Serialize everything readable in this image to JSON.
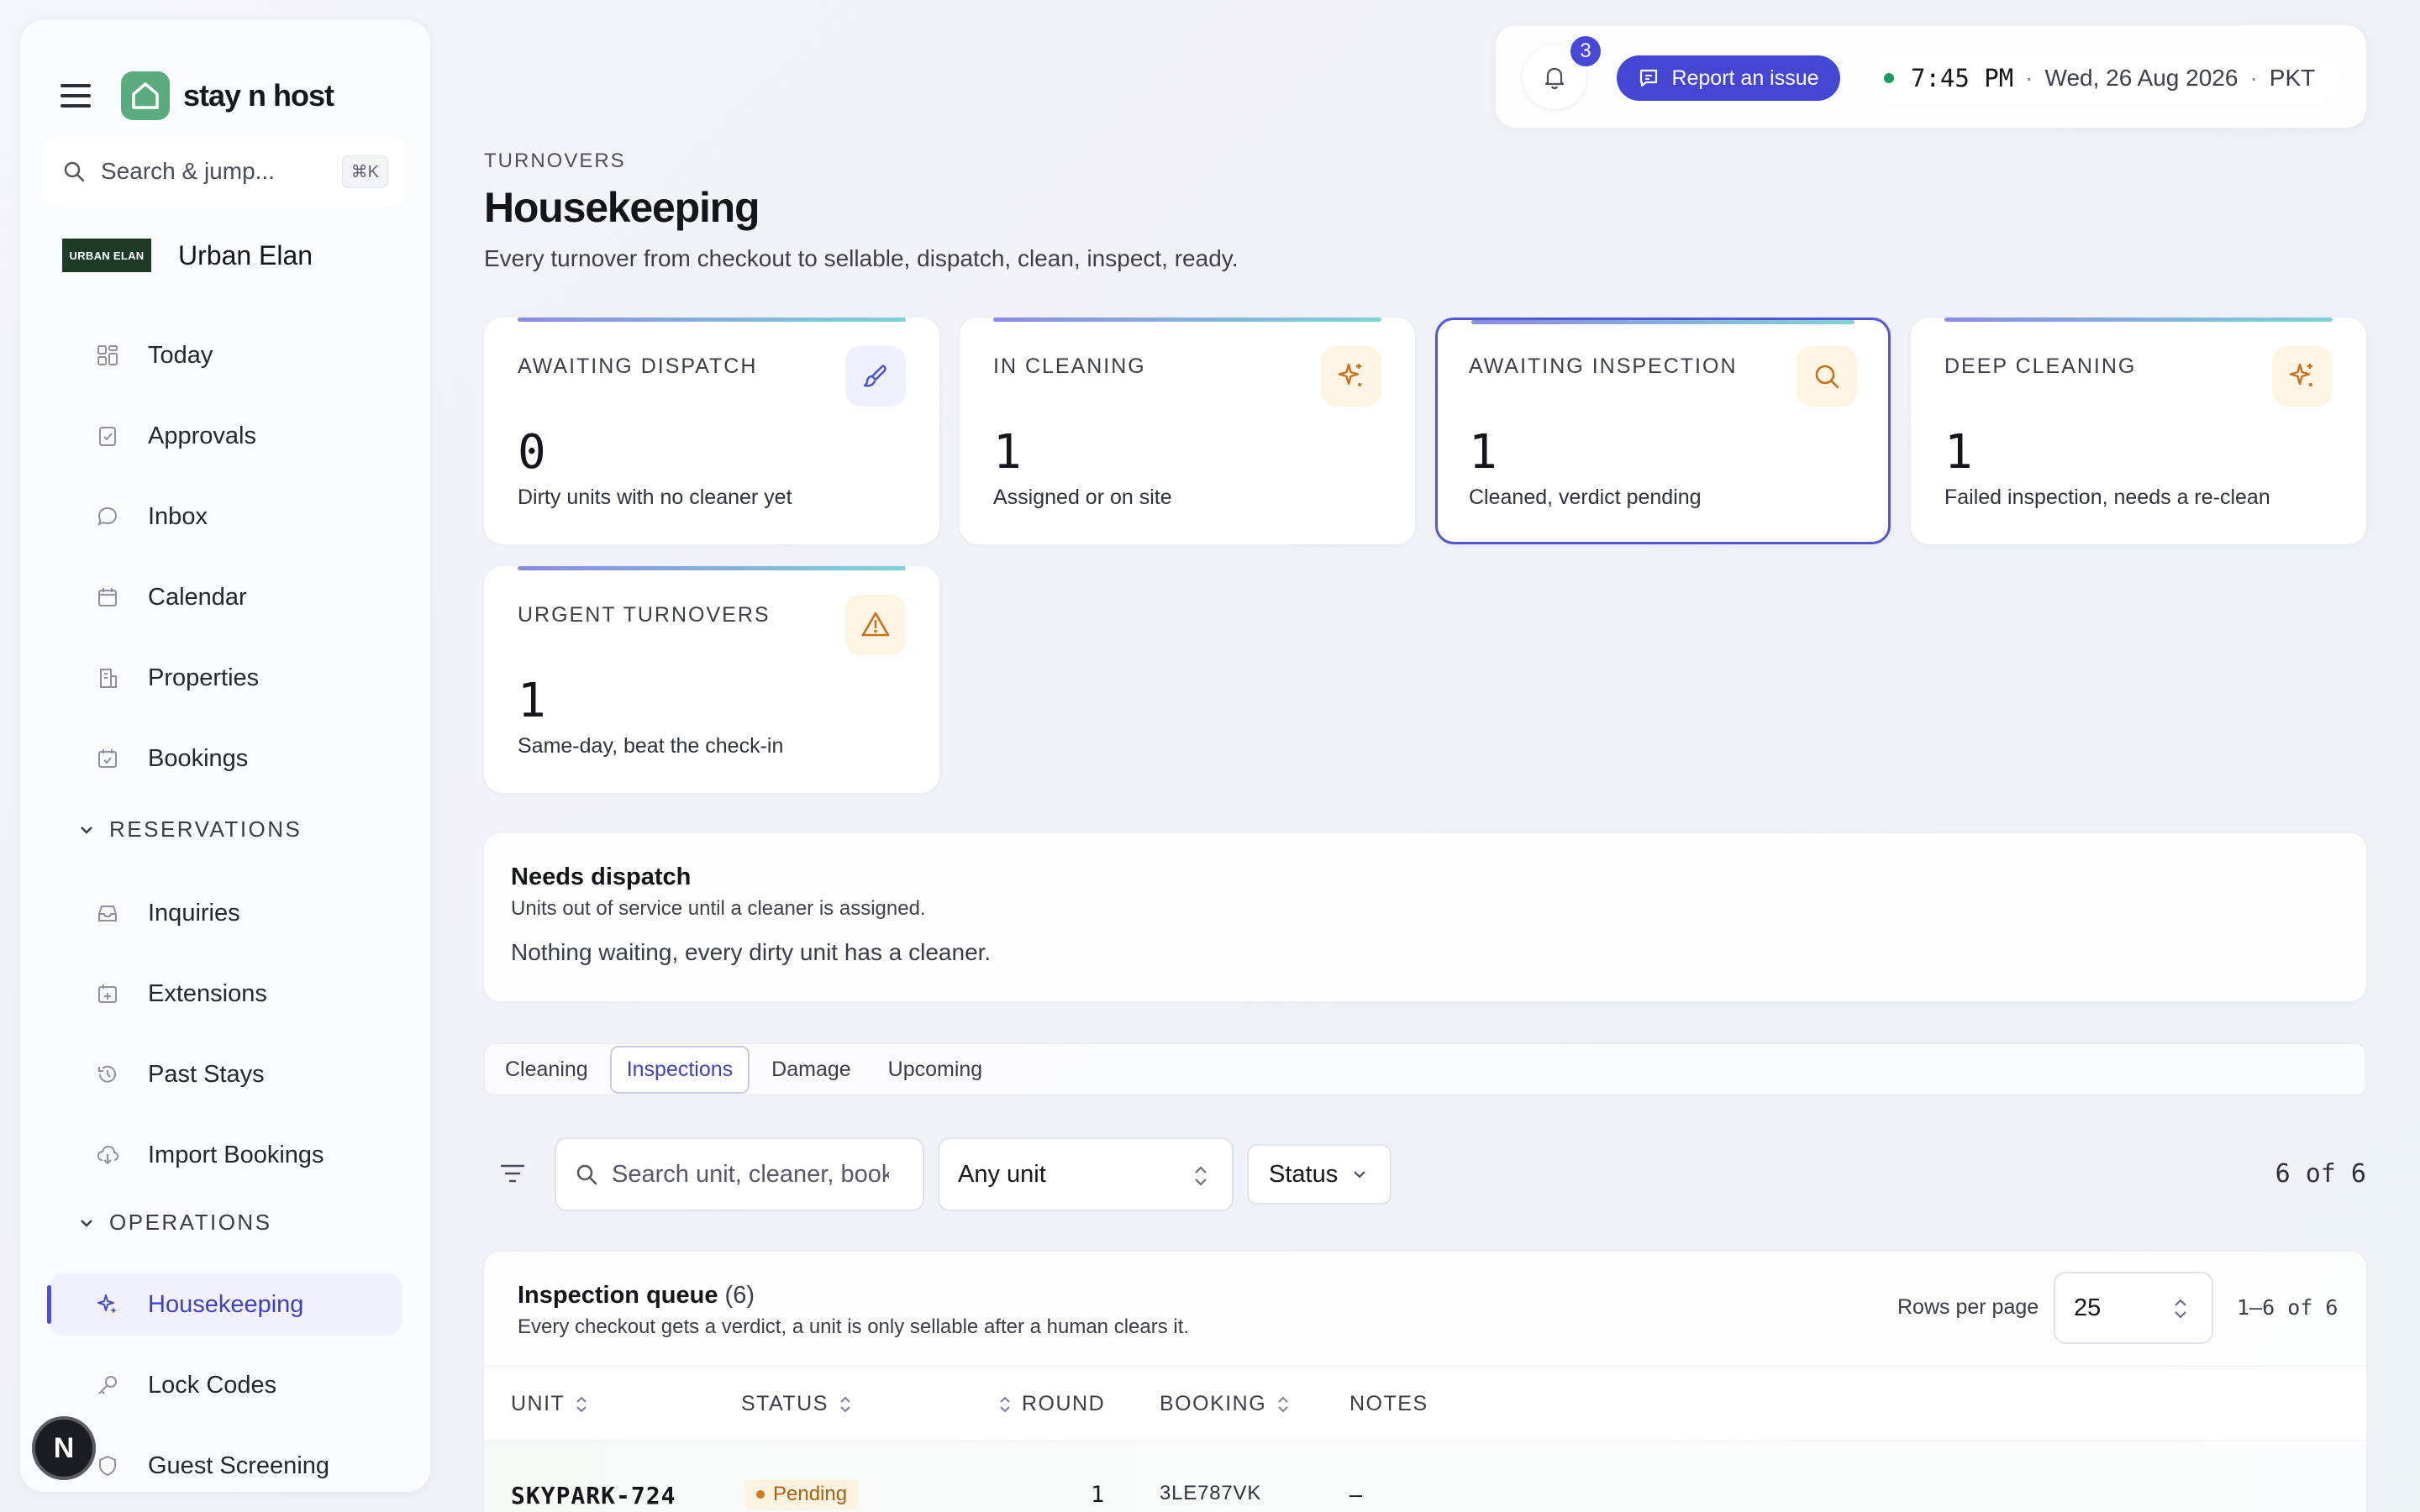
{
  "sidebar": {
    "brand": "stay n host",
    "search_placeholder": "Search & jump...",
    "search_shortcut": "⌘K",
    "org_logo_text": "URBAN ELAN",
    "org_name": "Urban Elan",
    "items": [
      {
        "label": "Today",
        "icon": "grid-icon"
      },
      {
        "label": "Approvals",
        "icon": "clipboard-check-icon"
      },
      {
        "label": "Inbox",
        "icon": "chat-bubble-icon"
      },
      {
        "label": "Calendar",
        "icon": "calendar-icon"
      },
      {
        "label": "Properties",
        "icon": "building-icon"
      },
      {
        "label": "Bookings",
        "icon": "calendar-check-icon"
      }
    ],
    "reservations_label": "RESERVATIONS",
    "reservations": [
      {
        "label": "Inquiries",
        "icon": "inbox-tray-icon"
      },
      {
        "label": "Extensions",
        "icon": "calendar-plus-icon"
      },
      {
        "label": "Past Stays",
        "icon": "history-icon"
      },
      {
        "label": "Import Bookings",
        "icon": "cloud-download-icon"
      }
    ],
    "operations_label": "OPERATIONS",
    "operations": [
      {
        "label": "Housekeeping",
        "icon": "sparkles-icon",
        "active": true
      },
      {
        "label": "Lock Codes",
        "icon": "key-icon"
      },
      {
        "label": "Guest Screening",
        "icon": "shield-user-icon"
      }
    ],
    "avatar_initial": "N"
  },
  "topbar": {
    "notification_count": "3",
    "report_label": "Report an issue",
    "time": "7:45 PM",
    "date": "Wed, 26 Aug 2026",
    "timezone": "PKT",
    "status_color": "#1f9a5e"
  },
  "header": {
    "eyebrow": "TURNOVERS",
    "title": "Housekeeping",
    "subtitle": "Every turnover from checkout to sellable, dispatch, clean, inspect, ready."
  },
  "stats": [
    {
      "label": "AWAITING DISPATCH",
      "value": "0",
      "desc": "Dirty units with no cleaner yet",
      "icon": "brush-icon"
    },
    {
      "label": "IN CLEANING",
      "value": "1",
      "desc": "Assigned or on site",
      "icon": "sparkles-icon"
    },
    {
      "label": "AWAITING INSPECTION",
      "value": "1",
      "desc": "Cleaned, verdict pending",
      "icon": "search-icon",
      "selected": true
    },
    {
      "label": "DEEP CLEANING",
      "value": "1",
      "desc": "Failed inspection, needs a re-clean",
      "icon": "sparkles-icon"
    },
    {
      "label": "URGENT TURNOVERS",
      "value": "1",
      "desc": "Same-day, beat the check-in",
      "icon": "warning-icon"
    }
  ],
  "dispatch": {
    "title": "Needs dispatch",
    "subtitle": "Units out of service until a cleaner is assigned.",
    "message": "Nothing waiting, every dirty unit has a cleaner."
  },
  "tabs": [
    {
      "label": "Cleaning"
    },
    {
      "label": "Inspections",
      "active": true
    },
    {
      "label": "Damage"
    },
    {
      "label": "Upcoming"
    }
  ],
  "filters": {
    "search_placeholder": "Search unit, cleaner, booking",
    "unit_value": "Any unit",
    "status_label": "Status",
    "count": "6 of 6"
  },
  "queue": {
    "title": "Inspection queue",
    "count": "(6)",
    "subtitle": "Every checkout gets a verdict, a unit is only sellable after a human clears it.",
    "rows_per_page_label": "Rows per page",
    "rows_per_page": "25",
    "range": "1–6 of 6",
    "columns": [
      "UNIT",
      "STATUS",
      "ROUND",
      "BOOKING",
      "NOTES"
    ],
    "rows": [
      {
        "unit": "SKYPARK-724",
        "status": "Pending",
        "round": "1",
        "booking": "3LE787VK",
        "notes": "–"
      }
    ]
  },
  "colors": {
    "accent": "#4547d4",
    "active_nav_text": "#3e3fc8",
    "pending_text": "#a95f12",
    "pending_bg": "#fdf3e1",
    "brand_green": "#5bab7f"
  }
}
